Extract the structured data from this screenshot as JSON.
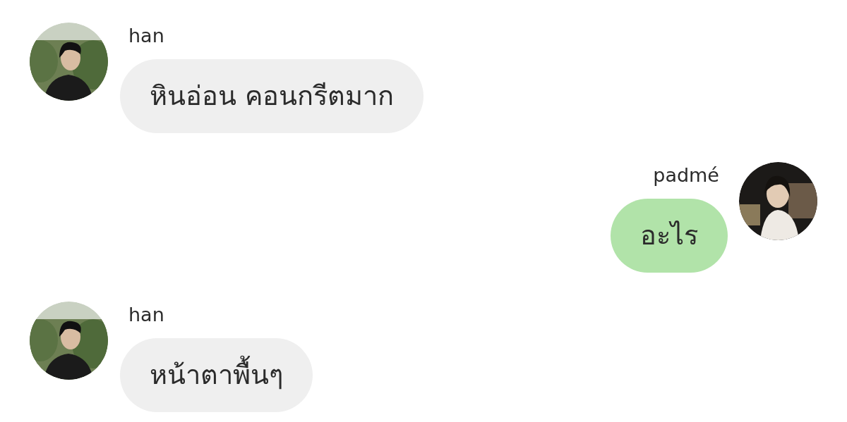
{
  "messages": [
    {
      "kind": "incoming",
      "sender": "han",
      "text": "หินอ่อน คอนกรีตมาก"
    },
    {
      "kind": "outgoing",
      "sender": "padmé",
      "text": "อะไร"
    },
    {
      "kind": "incoming",
      "sender": "han",
      "text": "หน้าตาพื้นๆ"
    }
  ]
}
